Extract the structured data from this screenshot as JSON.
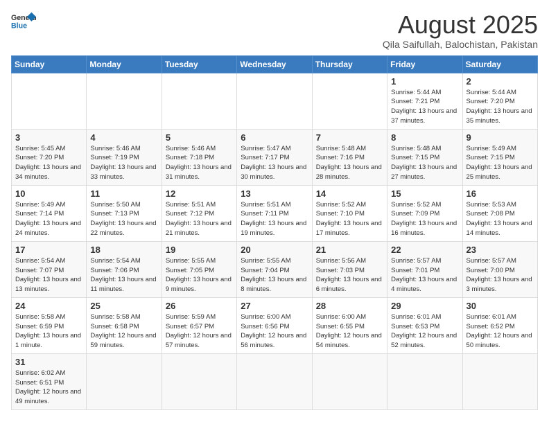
{
  "header": {
    "logo_general": "General",
    "logo_blue": "Blue",
    "title": "August 2025",
    "subtitle": "Qila Saifullah, Balochistan, Pakistan"
  },
  "weekdays": [
    "Sunday",
    "Monday",
    "Tuesday",
    "Wednesday",
    "Thursday",
    "Friday",
    "Saturday"
  ],
  "weeks": [
    [
      {
        "day": "",
        "info": ""
      },
      {
        "day": "",
        "info": ""
      },
      {
        "day": "",
        "info": ""
      },
      {
        "day": "",
        "info": ""
      },
      {
        "day": "",
        "info": ""
      },
      {
        "day": "1",
        "info": "Sunrise: 5:44 AM\nSunset: 7:21 PM\nDaylight: 13 hours\nand 37 minutes."
      },
      {
        "day": "2",
        "info": "Sunrise: 5:44 AM\nSunset: 7:20 PM\nDaylight: 13 hours\nand 35 minutes."
      }
    ],
    [
      {
        "day": "3",
        "info": "Sunrise: 5:45 AM\nSunset: 7:20 PM\nDaylight: 13 hours\nand 34 minutes."
      },
      {
        "day": "4",
        "info": "Sunrise: 5:46 AM\nSunset: 7:19 PM\nDaylight: 13 hours\nand 33 minutes."
      },
      {
        "day": "5",
        "info": "Sunrise: 5:46 AM\nSunset: 7:18 PM\nDaylight: 13 hours\nand 31 minutes."
      },
      {
        "day": "6",
        "info": "Sunrise: 5:47 AM\nSunset: 7:17 PM\nDaylight: 13 hours\nand 30 minutes."
      },
      {
        "day": "7",
        "info": "Sunrise: 5:48 AM\nSunset: 7:16 PM\nDaylight: 13 hours\nand 28 minutes."
      },
      {
        "day": "8",
        "info": "Sunrise: 5:48 AM\nSunset: 7:15 PM\nDaylight: 13 hours\nand 27 minutes."
      },
      {
        "day": "9",
        "info": "Sunrise: 5:49 AM\nSunset: 7:15 PM\nDaylight: 13 hours\nand 25 minutes."
      }
    ],
    [
      {
        "day": "10",
        "info": "Sunrise: 5:49 AM\nSunset: 7:14 PM\nDaylight: 13 hours\nand 24 minutes."
      },
      {
        "day": "11",
        "info": "Sunrise: 5:50 AM\nSunset: 7:13 PM\nDaylight: 13 hours\nand 22 minutes."
      },
      {
        "day": "12",
        "info": "Sunrise: 5:51 AM\nSunset: 7:12 PM\nDaylight: 13 hours\nand 21 minutes."
      },
      {
        "day": "13",
        "info": "Sunrise: 5:51 AM\nSunset: 7:11 PM\nDaylight: 13 hours\nand 19 minutes."
      },
      {
        "day": "14",
        "info": "Sunrise: 5:52 AM\nSunset: 7:10 PM\nDaylight: 13 hours\nand 17 minutes."
      },
      {
        "day": "15",
        "info": "Sunrise: 5:52 AM\nSunset: 7:09 PM\nDaylight: 13 hours\nand 16 minutes."
      },
      {
        "day": "16",
        "info": "Sunrise: 5:53 AM\nSunset: 7:08 PM\nDaylight: 13 hours\nand 14 minutes."
      }
    ],
    [
      {
        "day": "17",
        "info": "Sunrise: 5:54 AM\nSunset: 7:07 PM\nDaylight: 13 hours\nand 13 minutes."
      },
      {
        "day": "18",
        "info": "Sunrise: 5:54 AM\nSunset: 7:06 PM\nDaylight: 13 hours\nand 11 minutes."
      },
      {
        "day": "19",
        "info": "Sunrise: 5:55 AM\nSunset: 7:05 PM\nDaylight: 13 hours\nand 9 minutes."
      },
      {
        "day": "20",
        "info": "Sunrise: 5:55 AM\nSunset: 7:04 PM\nDaylight: 13 hours\nand 8 minutes."
      },
      {
        "day": "21",
        "info": "Sunrise: 5:56 AM\nSunset: 7:03 PM\nDaylight: 13 hours\nand 6 minutes."
      },
      {
        "day": "22",
        "info": "Sunrise: 5:57 AM\nSunset: 7:01 PM\nDaylight: 13 hours\nand 4 minutes."
      },
      {
        "day": "23",
        "info": "Sunrise: 5:57 AM\nSunset: 7:00 PM\nDaylight: 13 hours\nand 3 minutes."
      }
    ],
    [
      {
        "day": "24",
        "info": "Sunrise: 5:58 AM\nSunset: 6:59 PM\nDaylight: 13 hours\nand 1 minute."
      },
      {
        "day": "25",
        "info": "Sunrise: 5:58 AM\nSunset: 6:58 PM\nDaylight: 12 hours\nand 59 minutes."
      },
      {
        "day": "26",
        "info": "Sunrise: 5:59 AM\nSunset: 6:57 PM\nDaylight: 12 hours\nand 57 minutes."
      },
      {
        "day": "27",
        "info": "Sunrise: 6:00 AM\nSunset: 6:56 PM\nDaylight: 12 hours\nand 56 minutes."
      },
      {
        "day": "28",
        "info": "Sunrise: 6:00 AM\nSunset: 6:55 PM\nDaylight: 12 hours\nand 54 minutes."
      },
      {
        "day": "29",
        "info": "Sunrise: 6:01 AM\nSunset: 6:53 PM\nDaylight: 12 hours\nand 52 minutes."
      },
      {
        "day": "30",
        "info": "Sunrise: 6:01 AM\nSunset: 6:52 PM\nDaylight: 12 hours\nand 50 minutes."
      }
    ],
    [
      {
        "day": "31",
        "info": "Sunrise: 6:02 AM\nSunset: 6:51 PM\nDaylight: 12 hours\nand 49 minutes."
      },
      {
        "day": "",
        "info": ""
      },
      {
        "day": "",
        "info": ""
      },
      {
        "day": "",
        "info": ""
      },
      {
        "day": "",
        "info": ""
      },
      {
        "day": "",
        "info": ""
      },
      {
        "day": "",
        "info": ""
      }
    ]
  ]
}
